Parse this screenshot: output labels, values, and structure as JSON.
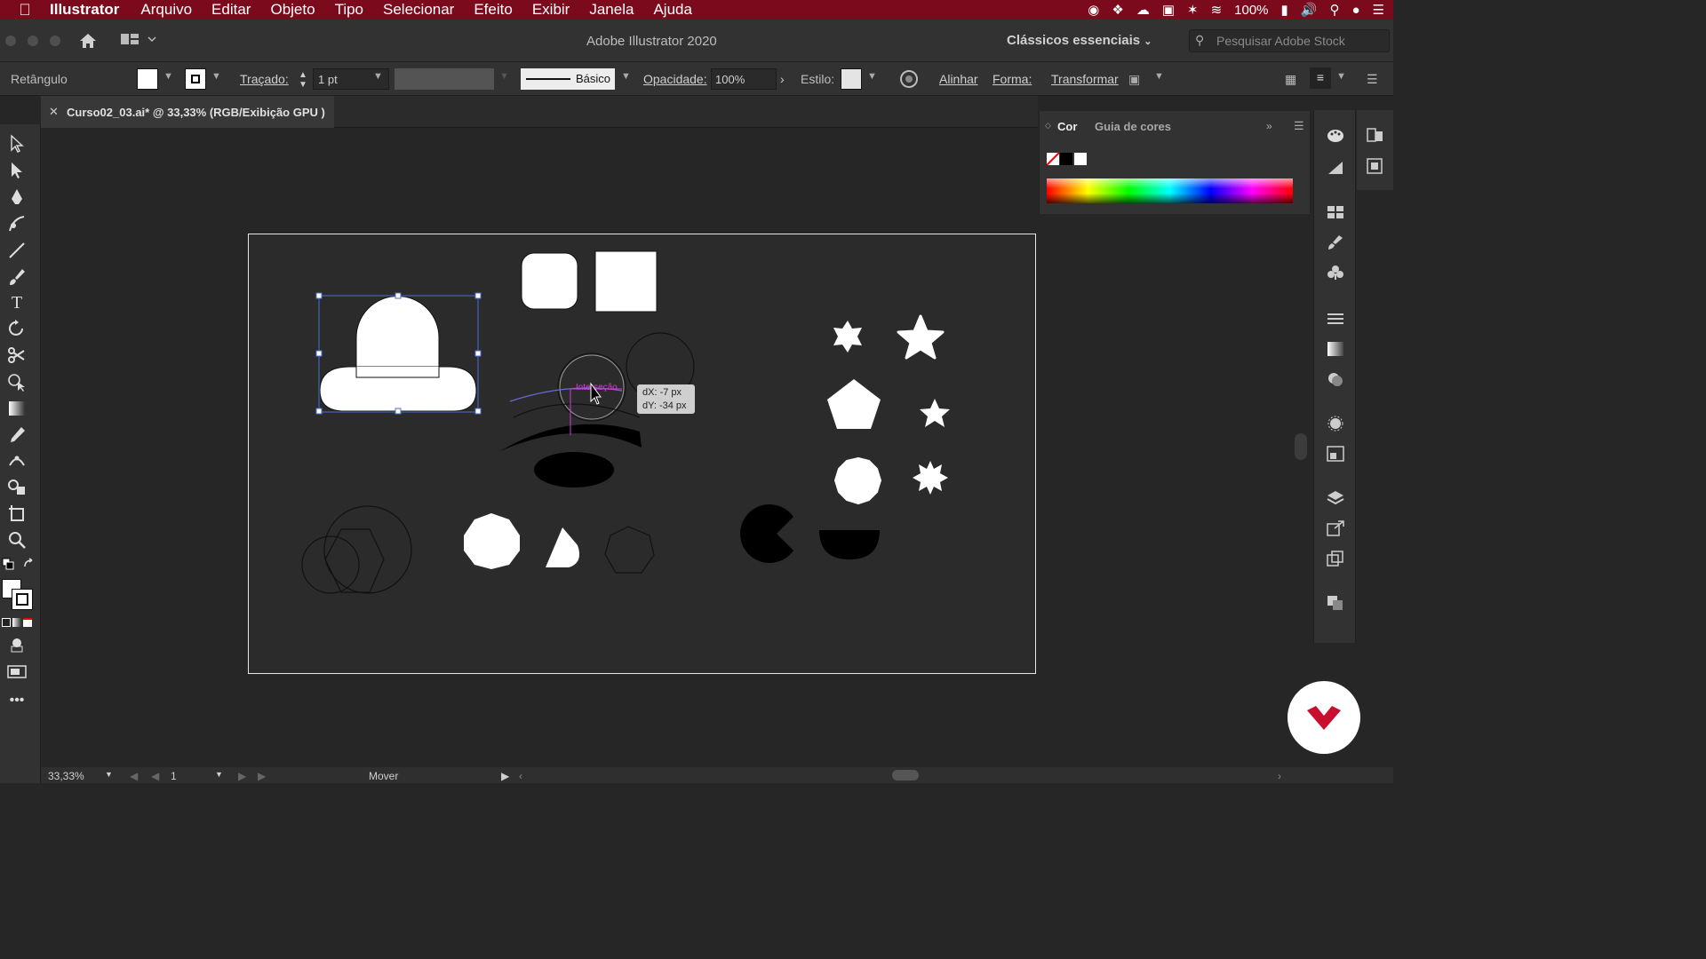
{
  "menubar": {
    "app": "Illustrator",
    "items": [
      "Arquivo",
      "Editar",
      "Objeto",
      "Tipo",
      "Selecionar",
      "Efeito",
      "Exibir",
      "Janela",
      "Ajuda"
    ],
    "battery": "100%"
  },
  "titlebar": {
    "title": "Adobe Illustrator 2020",
    "workspace": "Clássicos essenciais",
    "search_placeholder": "Pesquisar Adobe Stock"
  },
  "control": {
    "object_type": "Retângulo",
    "stroke_label": "Traçado:",
    "stroke_value": "1 pt",
    "brush_label": "Básico",
    "opacity_label": "Opacidade:",
    "opacity_value": "100%",
    "style_label": "Estilo:",
    "align": "Alinhar",
    "shape": "Forma:",
    "transform": "Transformar"
  },
  "document": {
    "tab": "Curso02_03.ai* @ 33,33% (RGB/Exibição GPU )"
  },
  "color_panel": {
    "tab_active": "Cor",
    "tab_other": "Guia de cores"
  },
  "smart_guide": {
    "label": "Interseção",
    "dx": "dX: -7 px",
    "dy": "dY: -34 px"
  },
  "status": {
    "zoom": "33,33%",
    "artboard": "1",
    "tool": "Mover"
  },
  "colors": {
    "menubar": "#7a0a1c",
    "selection": "#4a6cd4",
    "guide": "#d23bd2",
    "brand": "#c8102e"
  }
}
